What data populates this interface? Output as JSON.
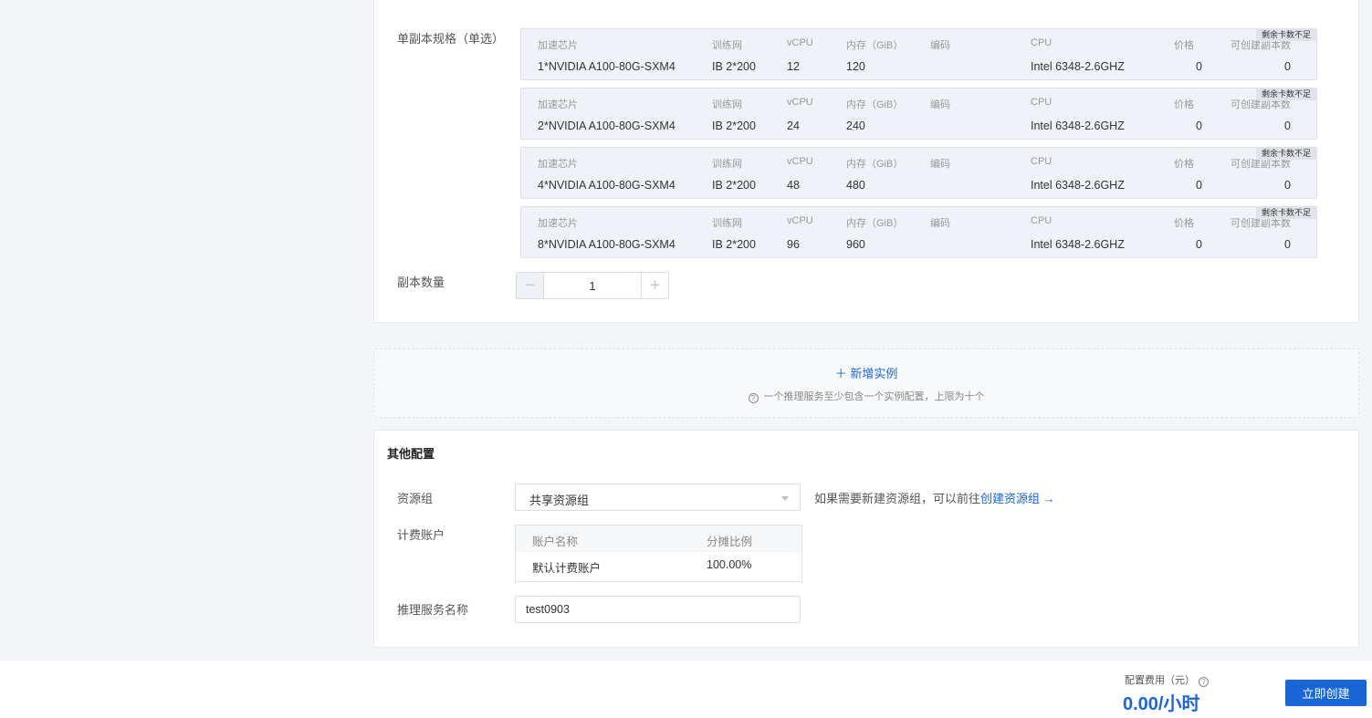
{
  "spec_section": {
    "spec_label": "单副本规格（单选）",
    "replica_label": "副本数量",
    "replica_value": "1",
    "headers": {
      "chip": "加速芯片",
      "network": "训练网",
      "vcpu": "vCPU",
      "memory": "内存（GiB）",
      "encoding": "编码",
      "cpu": "CPU",
      "price": "价格",
      "creatable": "可创建副本数"
    },
    "badge": "剩余卡数不足",
    "options": [
      {
        "chip": "1*NVIDIA A100-80G-SXM4",
        "network": "IB 2*200",
        "vcpu": "12",
        "memory": "120",
        "encoding": "",
        "cpu": "Intel 6348-2.6GHZ",
        "price": "0",
        "creatable": "0"
      },
      {
        "chip": "2*NVIDIA A100-80G-SXM4",
        "network": "IB 2*200",
        "vcpu": "24",
        "memory": "240",
        "encoding": "",
        "cpu": "Intel 6348-2.6GHZ",
        "price": "0",
        "creatable": "0"
      },
      {
        "chip": "4*NVIDIA A100-80G-SXM4",
        "network": "IB 2*200",
        "vcpu": "48",
        "memory": "480",
        "encoding": "",
        "cpu": "Intel 6348-2.6GHZ",
        "price": "0",
        "creatable": "0"
      },
      {
        "chip": "8*NVIDIA A100-80G-SXM4",
        "network": "IB 2*200",
        "vcpu": "96",
        "memory": "960",
        "encoding": "",
        "cpu": "Intel 6348-2.6GHZ",
        "price": "0",
        "creatable": "0"
      }
    ]
  },
  "add_instance": {
    "link": "新增实例",
    "hint": "一个推理服务至少包含一个实例配置，上限为十个"
  },
  "other_config": {
    "title": "其他配置",
    "resource_group_label": "资源组",
    "resource_group_value": "共享资源组",
    "resource_hint": "如果需要新建资源组，可以前往",
    "resource_link": "创建资源组",
    "billing_label": "计费账户",
    "billing_headers": {
      "name": "账户名称",
      "ratio": "分摊比例"
    },
    "billing_rows": [
      {
        "name": "默认计费账户",
        "ratio": "100.00%"
      }
    ],
    "service_name_label": "推理服务名称",
    "service_name_value": "test0903"
  },
  "footer": {
    "fee_label": "配置费用（元）",
    "fee_value": "0.00/小时",
    "create_button": "立即创建"
  }
}
